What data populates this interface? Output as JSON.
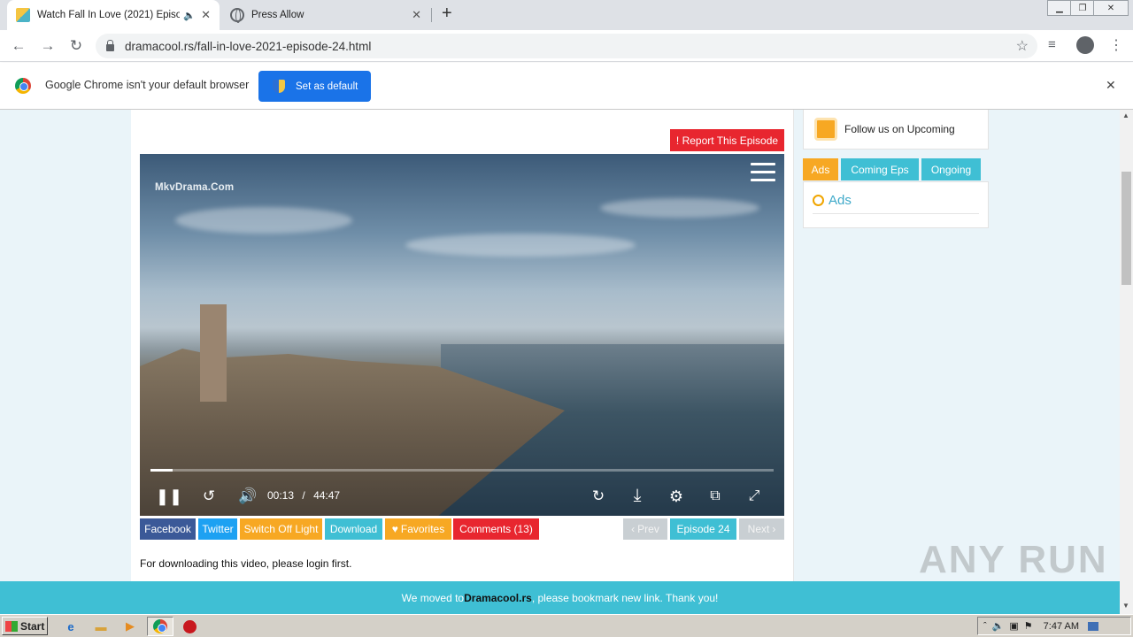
{
  "browser": {
    "tabs": [
      {
        "title": "Watch Fall In Love (2021) Episo",
        "active": true,
        "icon": "dramacool-favicon",
        "audio": true
      },
      {
        "title": "Press Allow",
        "active": false,
        "icon": "globe-icon"
      }
    ],
    "new_tab": "+",
    "url": "dramacool.rs/fall-in-love-2021-episode-24.html",
    "infobar": {
      "message": "Google Chrome isn't your default browser",
      "button": "Set as default",
      "close": "✕"
    }
  },
  "page": {
    "report_button": "! Report This Episode",
    "video": {
      "watermark": "MkvDrama.Com",
      "current_time": "00:13",
      "separator": "/",
      "duration": "44:47",
      "progress_fraction": 0.005
    },
    "share_buttons": [
      {
        "label": "Facebook",
        "color": "#3b5998"
      },
      {
        "label": "Twitter",
        "color": "#1da1f2"
      },
      {
        "label": "Switch Off Light",
        "color": "#f7a823"
      },
      {
        "label": "Download",
        "color": "#3fbfd4"
      },
      {
        "label": "Favorites",
        "color": "#f7a823"
      },
      {
        "label": "Comments (13)",
        "color": "#e8262f"
      }
    ],
    "episode_nav": {
      "prev": "Prev",
      "current": "Episode 24",
      "next": "Next"
    },
    "login_note": "For downloading this video, please login first.",
    "sidebar": {
      "follow": "Follow us on Upcoming",
      "tabs": [
        {
          "label": "Ads",
          "color": "#f7a823"
        },
        {
          "label": "Coming Eps",
          "color": "#3fbfd4"
        },
        {
          "label": "Ongoing",
          "color": "#3fbfd4"
        }
      ],
      "ads_title": "Ads"
    },
    "banner": {
      "before": "We moved to ",
      "site": "Dramacool.rs",
      "after": ", please bookmark new link. Thank you!"
    }
  },
  "taskbar": {
    "start": "Start",
    "time": "7:47 AM"
  },
  "watermark_text": "ANY RUN"
}
